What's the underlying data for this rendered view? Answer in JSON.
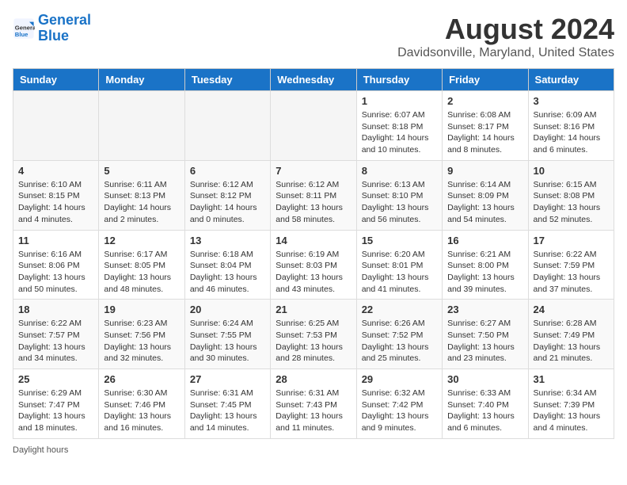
{
  "header": {
    "logo_line1": "General",
    "logo_line2": "Blue",
    "title": "August 2024",
    "subtitle": "Davidsonville, Maryland, United States"
  },
  "calendar": {
    "weekdays": [
      "Sunday",
      "Monday",
      "Tuesday",
      "Wednesday",
      "Thursday",
      "Friday",
      "Saturday"
    ],
    "weeks": [
      [
        {
          "day": "",
          "info": ""
        },
        {
          "day": "",
          "info": ""
        },
        {
          "day": "",
          "info": ""
        },
        {
          "day": "",
          "info": ""
        },
        {
          "day": "1",
          "info": "Sunrise: 6:07 AM\nSunset: 8:18 PM\nDaylight: 14 hours\nand 10 minutes."
        },
        {
          "day": "2",
          "info": "Sunrise: 6:08 AM\nSunset: 8:17 PM\nDaylight: 14 hours\nand 8 minutes."
        },
        {
          "day": "3",
          "info": "Sunrise: 6:09 AM\nSunset: 8:16 PM\nDaylight: 14 hours\nand 6 minutes."
        }
      ],
      [
        {
          "day": "4",
          "info": "Sunrise: 6:10 AM\nSunset: 8:15 PM\nDaylight: 14 hours\nand 4 minutes."
        },
        {
          "day": "5",
          "info": "Sunrise: 6:11 AM\nSunset: 8:13 PM\nDaylight: 14 hours\nand 2 minutes."
        },
        {
          "day": "6",
          "info": "Sunrise: 6:12 AM\nSunset: 8:12 PM\nDaylight: 14 hours\nand 0 minutes."
        },
        {
          "day": "7",
          "info": "Sunrise: 6:12 AM\nSunset: 8:11 PM\nDaylight: 13 hours\nand 58 minutes."
        },
        {
          "day": "8",
          "info": "Sunrise: 6:13 AM\nSunset: 8:10 PM\nDaylight: 13 hours\nand 56 minutes."
        },
        {
          "day": "9",
          "info": "Sunrise: 6:14 AM\nSunset: 8:09 PM\nDaylight: 13 hours\nand 54 minutes."
        },
        {
          "day": "10",
          "info": "Sunrise: 6:15 AM\nSunset: 8:08 PM\nDaylight: 13 hours\nand 52 minutes."
        }
      ],
      [
        {
          "day": "11",
          "info": "Sunrise: 6:16 AM\nSunset: 8:06 PM\nDaylight: 13 hours\nand 50 minutes."
        },
        {
          "day": "12",
          "info": "Sunrise: 6:17 AM\nSunset: 8:05 PM\nDaylight: 13 hours\nand 48 minutes."
        },
        {
          "day": "13",
          "info": "Sunrise: 6:18 AM\nSunset: 8:04 PM\nDaylight: 13 hours\nand 46 minutes."
        },
        {
          "day": "14",
          "info": "Sunrise: 6:19 AM\nSunset: 8:03 PM\nDaylight: 13 hours\nand 43 minutes."
        },
        {
          "day": "15",
          "info": "Sunrise: 6:20 AM\nSunset: 8:01 PM\nDaylight: 13 hours\nand 41 minutes."
        },
        {
          "day": "16",
          "info": "Sunrise: 6:21 AM\nSunset: 8:00 PM\nDaylight: 13 hours\nand 39 minutes."
        },
        {
          "day": "17",
          "info": "Sunrise: 6:22 AM\nSunset: 7:59 PM\nDaylight: 13 hours\nand 37 minutes."
        }
      ],
      [
        {
          "day": "18",
          "info": "Sunrise: 6:22 AM\nSunset: 7:57 PM\nDaylight: 13 hours\nand 34 minutes."
        },
        {
          "day": "19",
          "info": "Sunrise: 6:23 AM\nSunset: 7:56 PM\nDaylight: 13 hours\nand 32 minutes."
        },
        {
          "day": "20",
          "info": "Sunrise: 6:24 AM\nSunset: 7:55 PM\nDaylight: 13 hours\nand 30 minutes."
        },
        {
          "day": "21",
          "info": "Sunrise: 6:25 AM\nSunset: 7:53 PM\nDaylight: 13 hours\nand 28 minutes."
        },
        {
          "day": "22",
          "info": "Sunrise: 6:26 AM\nSunset: 7:52 PM\nDaylight: 13 hours\nand 25 minutes."
        },
        {
          "day": "23",
          "info": "Sunrise: 6:27 AM\nSunset: 7:50 PM\nDaylight: 13 hours\nand 23 minutes."
        },
        {
          "day": "24",
          "info": "Sunrise: 6:28 AM\nSunset: 7:49 PM\nDaylight: 13 hours\nand 21 minutes."
        }
      ],
      [
        {
          "day": "25",
          "info": "Sunrise: 6:29 AM\nSunset: 7:47 PM\nDaylight: 13 hours\nand 18 minutes."
        },
        {
          "day": "26",
          "info": "Sunrise: 6:30 AM\nSunset: 7:46 PM\nDaylight: 13 hours\nand 16 minutes."
        },
        {
          "day": "27",
          "info": "Sunrise: 6:31 AM\nSunset: 7:45 PM\nDaylight: 13 hours\nand 14 minutes."
        },
        {
          "day": "28",
          "info": "Sunrise: 6:31 AM\nSunset: 7:43 PM\nDaylight: 13 hours\nand 11 minutes."
        },
        {
          "day": "29",
          "info": "Sunrise: 6:32 AM\nSunset: 7:42 PM\nDaylight: 13 hours\nand 9 minutes."
        },
        {
          "day": "30",
          "info": "Sunrise: 6:33 AM\nSunset: 7:40 PM\nDaylight: 13 hours\nand 6 minutes."
        },
        {
          "day": "31",
          "info": "Sunrise: 6:34 AM\nSunset: 7:39 PM\nDaylight: 13 hours\nand 4 minutes."
        }
      ]
    ]
  },
  "footer": {
    "note": "Daylight hours"
  }
}
